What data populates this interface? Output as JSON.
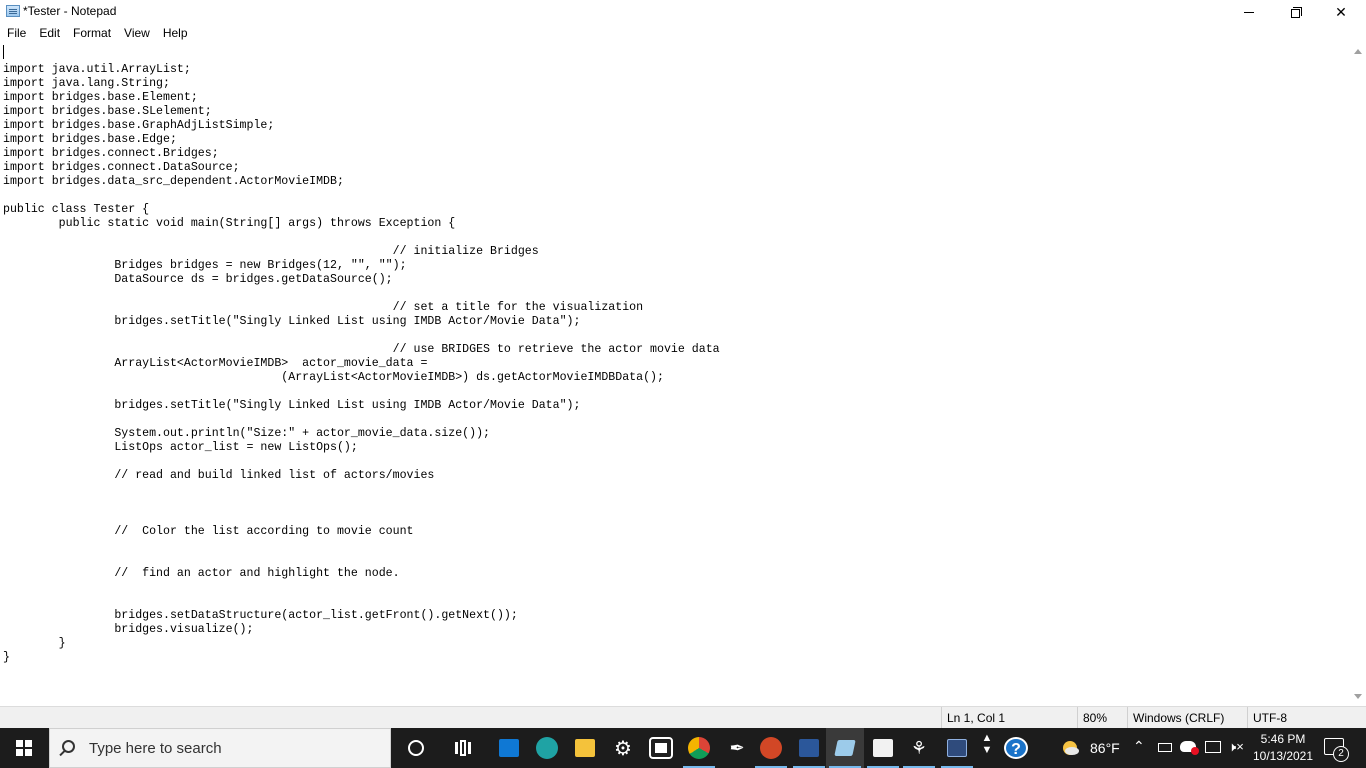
{
  "window": {
    "title": "*Tester - Notepad"
  },
  "menu": {
    "items": [
      "File",
      "Edit",
      "Format",
      "View",
      "Help"
    ]
  },
  "editor": {
    "text": "\nimport java.util.ArrayList;\nimport java.lang.String;\nimport bridges.base.Element;\nimport bridges.base.SLelement;\nimport bridges.base.GraphAdjListSimple;\nimport bridges.base.Edge;\nimport bridges.connect.Bridges;\nimport bridges.connect.DataSource;\nimport bridges.data_src_dependent.ActorMovieIMDB;\n\npublic class Tester {\n        public static void main(String[] args) throws Exception {\n\n                                                        // initialize Bridges\n                Bridges bridges = new Bridges(12, \"\", \"\");\n                DataSource ds = bridges.getDataSource();\n\n                                                        // set a title for the visualization\n                bridges.setTitle(\"Singly Linked List using IMDB Actor/Movie Data\");\n\n                                                        // use BRIDGES to retrieve the actor movie data\n                ArrayList<ActorMovieIMDB>  actor_movie_data =\n                                        (ArrayList<ActorMovieIMDB>) ds.getActorMovieIMDBData();\n\n                bridges.setTitle(\"Singly Linked List using IMDB Actor/Movie Data\");\n\n                System.out.println(\"Size:\" + actor_movie_data.size());\n                ListOps actor_list = new ListOps();\n\n                // read and build linked list of actors/movies\n\n\n\n                //  Color the list according to movie count\n\n\n                //  find an actor and highlight the node.\n\n\n                bridges.setDataStructure(actor_list.getFront().getNext());\n                bridges.visualize();\n        }\n}"
  },
  "status": {
    "position": "Ln 1, Col 1",
    "zoom": "80%",
    "line_ending": "Windows (CRLF)",
    "encoding": "UTF-8"
  },
  "taskbar": {
    "search_placeholder": "Type here to search",
    "weather_temp": "86°F",
    "time": "5:46 PM",
    "date": "10/13/2021",
    "notification_count": "2",
    "pinned_icons": [
      "cortana-icon",
      "task-view-icon",
      "mail-icon",
      "edge-icon",
      "file-explorer-icon",
      "settings-icon",
      "store-icon",
      "chrome-icon",
      "inkscape-icon",
      "powerpoint-icon",
      "word-icon",
      "notepad-icon",
      "java-app-icon",
      "git-icon",
      "network-tool-icon"
    ],
    "colors": {
      "taskbar_bg": "#1c1c1c",
      "active_indicator": "#76b9ed",
      "help_blue": "#1a73c9"
    }
  }
}
